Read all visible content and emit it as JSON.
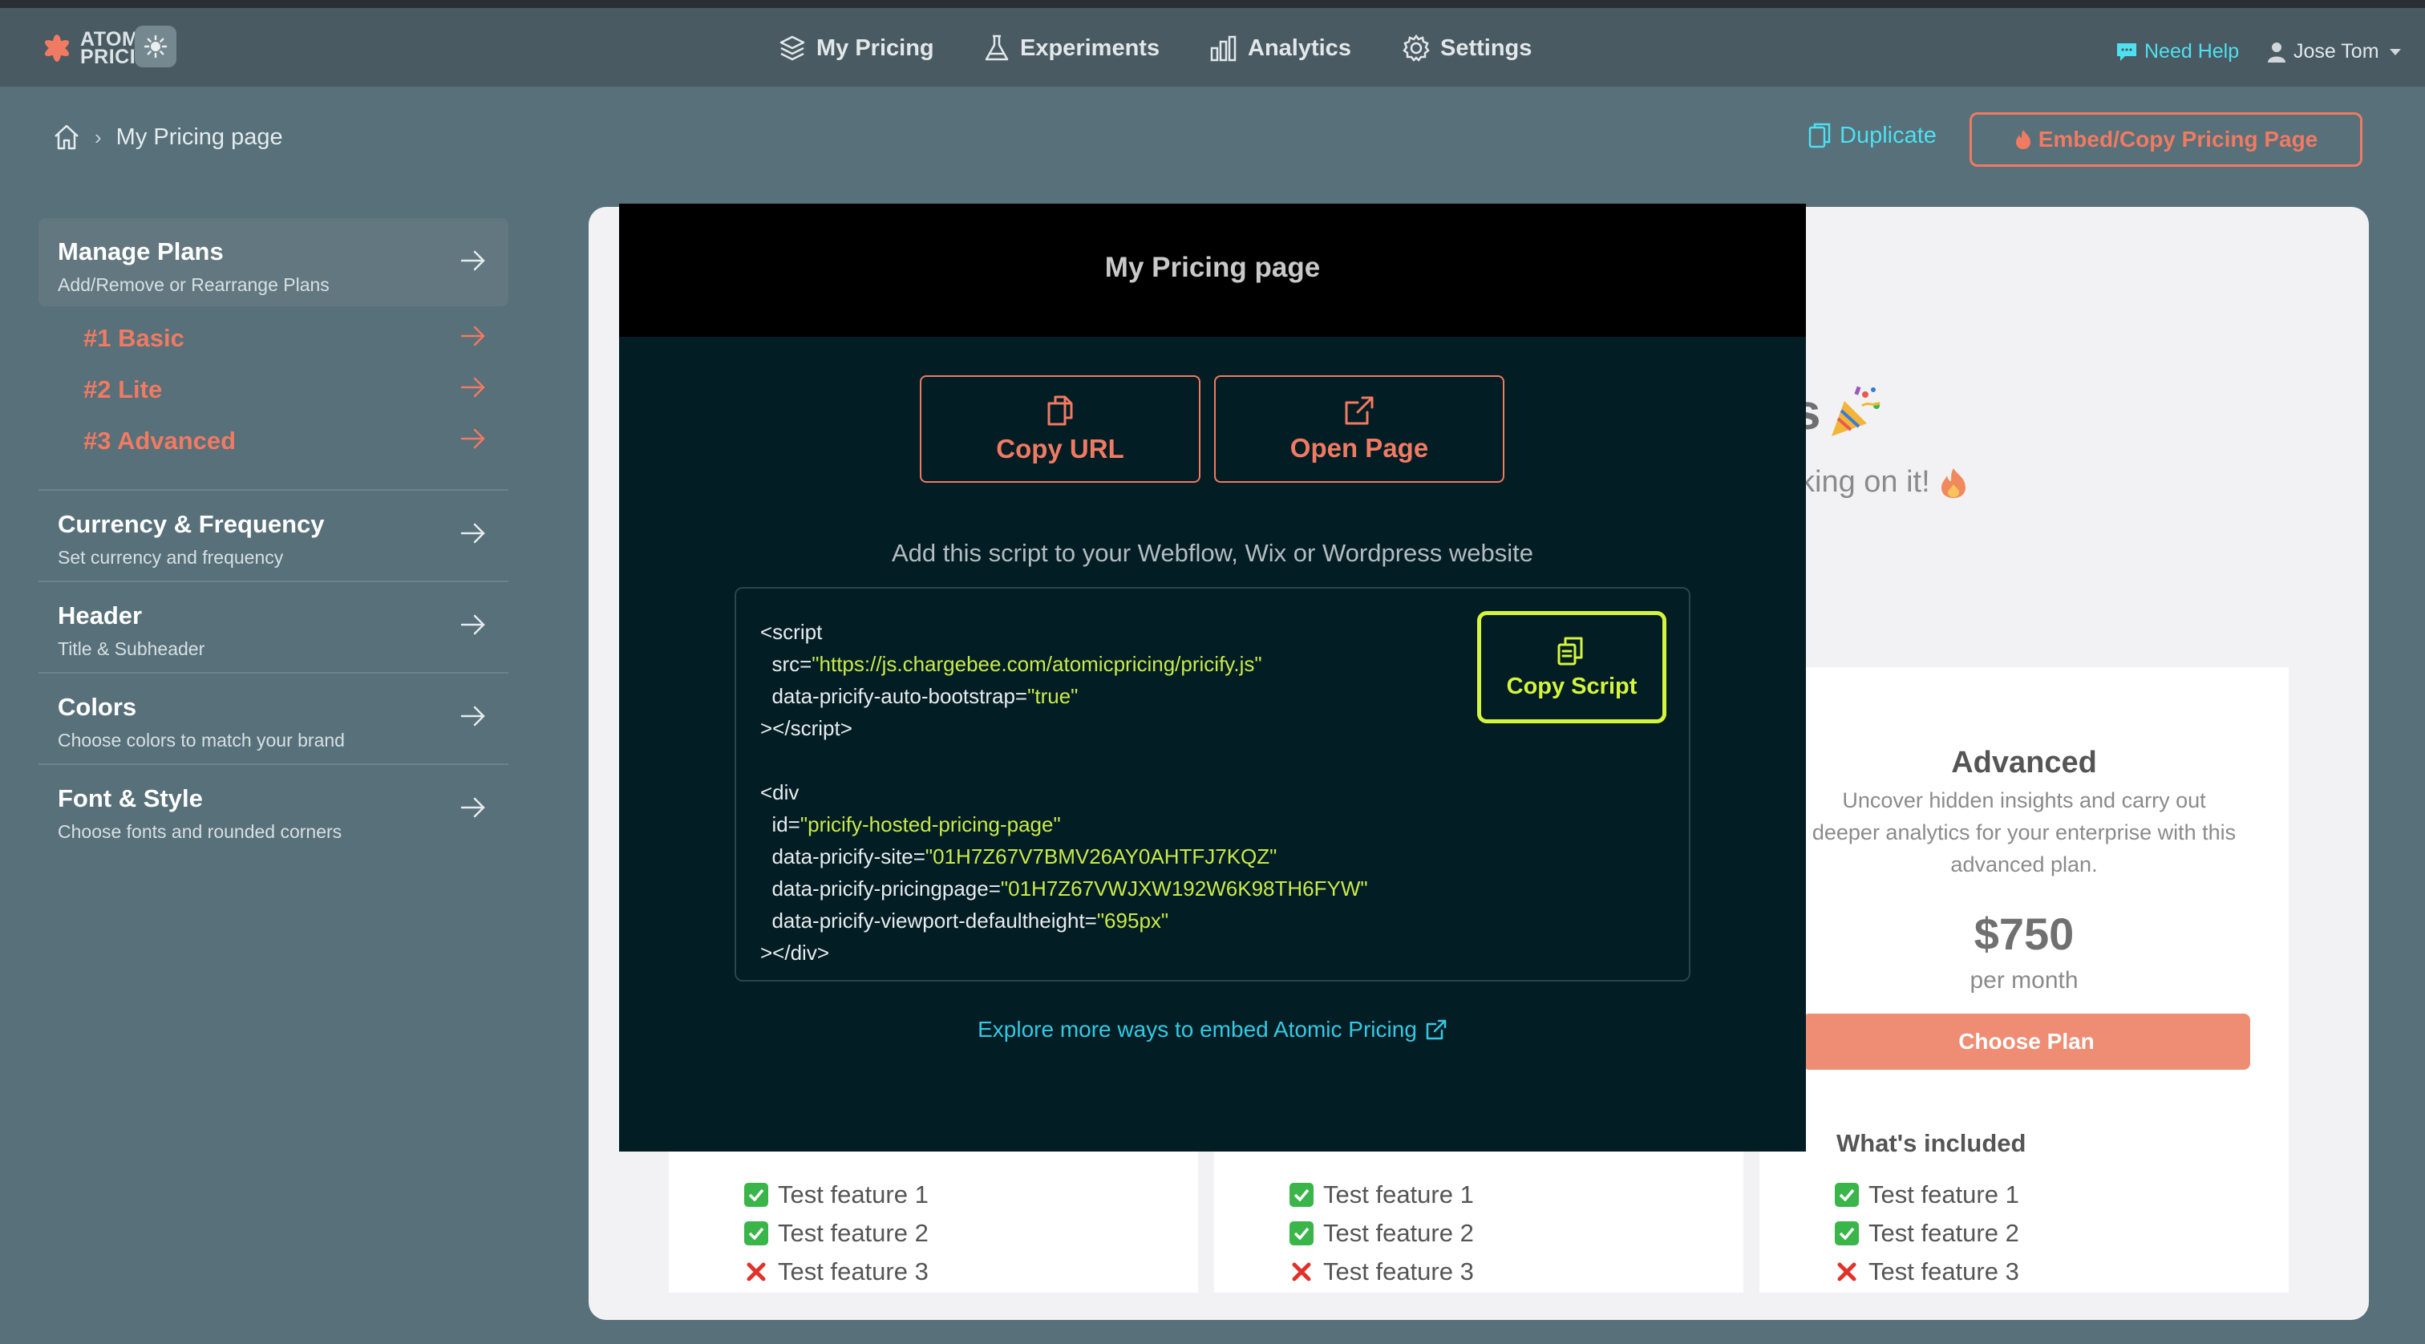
{
  "app": {
    "logo_line1": "ATOMIC",
    "logo_line2": "PRICING"
  },
  "nav": {
    "items": [
      {
        "label": "My Pricing",
        "icon": "layers-icon"
      },
      {
        "label": "Experiments",
        "icon": "flask-icon"
      },
      {
        "label": "Analytics",
        "icon": "bar-chart-icon"
      },
      {
        "label": "Settings",
        "icon": "gear-icon"
      }
    ],
    "help": "Need Help",
    "user": "Jose Tom"
  },
  "subheader": {
    "breadcrumb_page": "My Pricing page",
    "duplicate": "Duplicate",
    "embed": "Embed/Copy Pricing Page"
  },
  "sidebar": {
    "manage": {
      "title": "Manage Plans",
      "subtitle": "Add/Remove or Rearrange Plans"
    },
    "plans": [
      "#1 Basic",
      "#2 Lite",
      "#3 Advanced"
    ],
    "sections": [
      {
        "title": "Currency & Frequency",
        "subtitle": "Set currency and frequency"
      },
      {
        "title": "Header",
        "subtitle": "Title & Subheader"
      },
      {
        "title": "Colors",
        "subtitle": "Choose colors to match your brand"
      },
      {
        "title": "Font & Style",
        "subtitle": "Choose fonts and rounded corners"
      }
    ]
  },
  "preview": {
    "heading_fragment": "s",
    "sub_fragment": "king on it!",
    "advanced": {
      "title": "Advanced",
      "description": "Uncover hidden insights and carry out deeper analytics for your enterprise with this advanced plan.",
      "price": "$750",
      "period": "per month",
      "cta": "Choose Plan",
      "included_label": "What's included"
    },
    "features": [
      {
        "label": "Test feature 1",
        "included": true
      },
      {
        "label": "Test feature 2",
        "included": true
      },
      {
        "label": "Test feature 3",
        "included": false
      }
    ]
  },
  "modal": {
    "title": "My Pricing page",
    "copy_url": "Copy URL",
    "open_page": "Open Page",
    "instructions": "Add this script to your Webflow, Wix or Wordpress website",
    "copy_script": "Copy Script",
    "script_src": "\"https://js.chargebee.com/atomicpricing/pricify.js\"",
    "bootstrap_value": "\"true\"",
    "div_id": "\"pricify-hosted-pricing-page\"",
    "site": "\"01H7Z67V7BMV26AY0AHTFJ7KQZ\"",
    "pricingpage": "\"01H7Z67VWJXW192W6K98TH6FYW\"",
    "viewport_height": "\"695px\"",
    "explore_link": "Explore more ways to embed Atomic Pricing"
  },
  "colors": {
    "accent": "#f07a62",
    "cyan": "#4ee0f0",
    "lime": "#d4f53c",
    "modal_bg": "#031d24"
  }
}
